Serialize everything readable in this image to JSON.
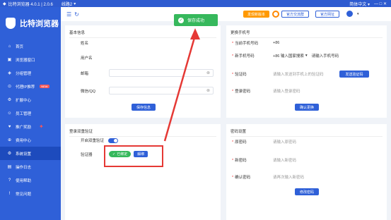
{
  "titlebar": {
    "app_name": "比特浏览器 4.0.1 | 2.0.6",
    "tab": "线路2",
    "lang": "简体中文",
    "win_controls": "—  □  ✕"
  },
  "sidebar": {
    "logo_text": "比特浏览器",
    "items": [
      {
        "label": "首页",
        "icon": "home-icon"
      },
      {
        "label": "浏览器窗口",
        "icon": "window-icon"
      },
      {
        "label": "分组管理",
        "icon": "group-icon"
      },
      {
        "label": "代理IP推荐",
        "icon": "proxy-icon",
        "badge": "NEW"
      },
      {
        "label": "扩展中心",
        "icon": "extension-icon"
      },
      {
        "label": "员工管理",
        "icon": "staff-icon"
      },
      {
        "label": "推广奖励",
        "icon": "reward-icon"
      },
      {
        "label": "费用中心",
        "icon": "billing-icon"
      },
      {
        "label": "系统设置",
        "icon": "settings-icon"
      },
      {
        "label": "操作日志",
        "icon": "log-icon"
      },
      {
        "label": "使用帮助",
        "icon": "help-icon"
      },
      {
        "label": "常见问题",
        "icon": "faq-icon"
      }
    ]
  },
  "topbar": {
    "new_version": "发现新版本",
    "feedback": "官方交流群",
    "official_site": "官方网址",
    "username": "          "
  },
  "toast": {
    "text": "保存成功"
  },
  "basic_info": {
    "title": "基本信息",
    "name_label": "姓名",
    "username_label": "用户名",
    "email_label": "邮箱",
    "email_value": "",
    "wechat_label": "微信/QQ",
    "wechat_value": "",
    "save_button": "保存信息"
  },
  "change_phone": {
    "title": "更换手机号",
    "old_label": "当前手机号码",
    "old_value": "+86",
    "new_label": "新手机号码",
    "new_code": "+86 输入国家搜索",
    "new_placeholder": "请输入手机号码",
    "code_label": "验证码",
    "code_placeholder": "请输入发送到手机上的验证码",
    "send_code": "发送验证码",
    "pwd_label": "登录密码",
    "pwd_placeholder": "请输入登录密码",
    "confirm": "确认更换"
  },
  "two_factor": {
    "title": "登录双重验证",
    "enable_label": "开启双重验证",
    "auth_label": "验证器",
    "bound": "已绑定",
    "unbind": "解绑"
  },
  "password": {
    "title": "密码设置",
    "old_label": "原密码",
    "old_placeholder": "请输入原密码",
    "new_label": "新密码",
    "new_placeholder": "请输入新密码",
    "confirm_label": "确认密码",
    "confirm_placeholder": "请再次输入新密码",
    "submit": "修改密码"
  },
  "colors": {
    "primary": "#2f60d8",
    "success": "#36b85c",
    "warn": "#ff9900",
    "annotation": "#e53935"
  }
}
